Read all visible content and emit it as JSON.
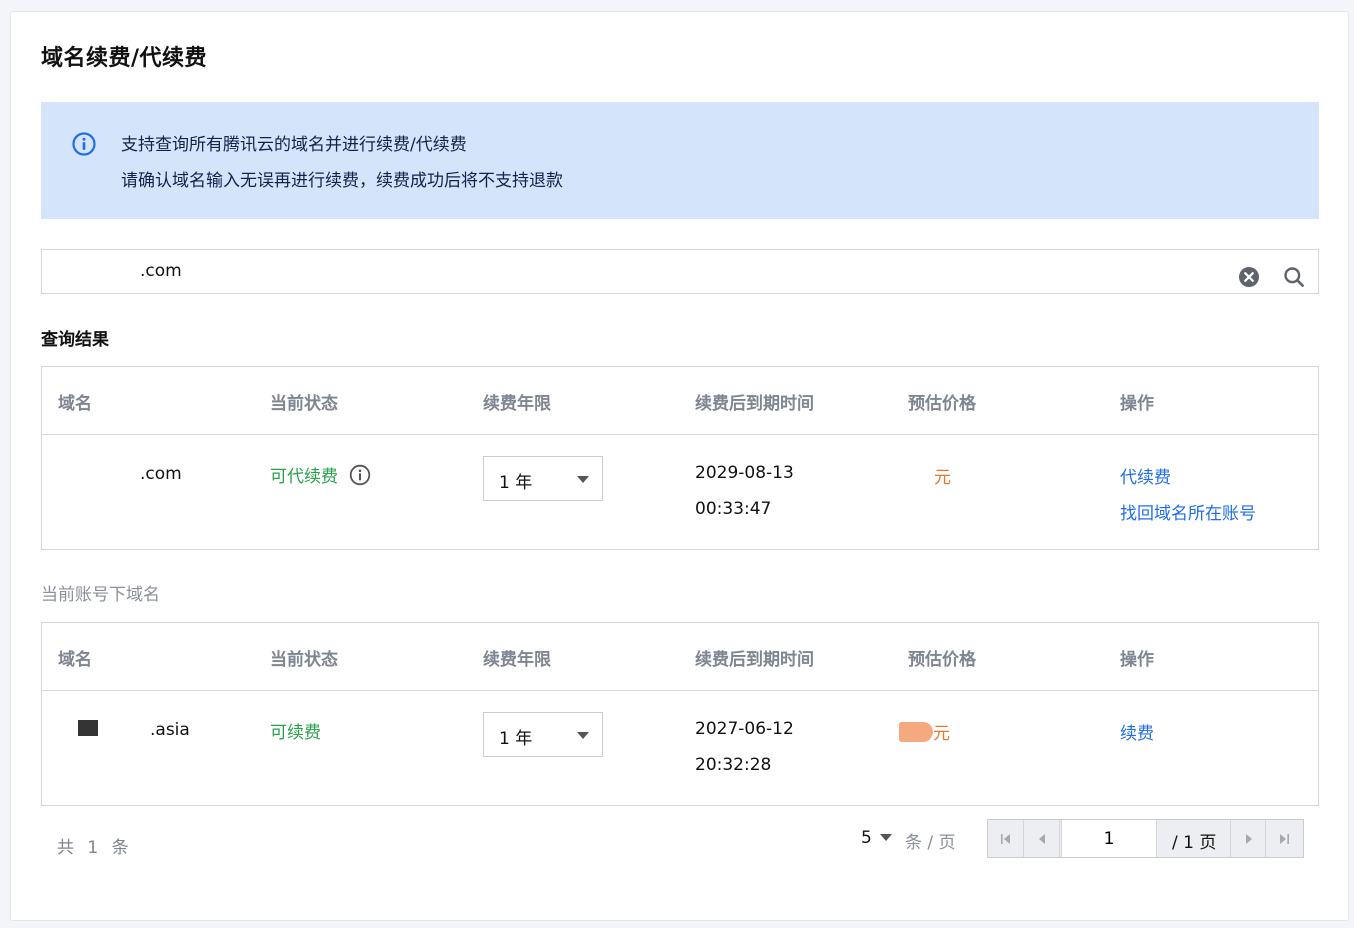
{
  "page": {
    "title": "域名续费/代续费"
  },
  "notice": {
    "line1": "支持查询所有腾讯云的域名并进行续费/代续费",
    "line2": "请确认域名输入无误再进行续费，续费成功后将不支持退款"
  },
  "search": {
    "value": ".com"
  },
  "query_results": {
    "title": "查询结果",
    "headers": [
      "域名",
      "当前状态",
      "续费年限",
      "续费后到期时间",
      "预估价格",
      "操作"
    ],
    "rows": [
      {
        "domain": ".com",
        "status": "可代续费",
        "term": "1 年",
        "expire_date": "2029-08-13",
        "expire_time": "00:33:47",
        "price_unit": "元",
        "actions": [
          "代续费",
          "找回域名所在账号"
        ]
      }
    ]
  },
  "account_domains": {
    "title": "当前账号下域名",
    "headers": [
      "域名",
      "当前状态",
      "续费年限",
      "续费后到期时间",
      "预估价格",
      "操作"
    ],
    "rows": [
      {
        "domain": ".asia",
        "status": "可续费",
        "term": "1 年",
        "expire_date": "2027-06-12",
        "expire_time": "20:32:28",
        "price_unit": "元",
        "actions": [
          "续费"
        ]
      }
    ]
  },
  "pagination": {
    "total_text": "共 1 条",
    "page_size": "5",
    "page_size_label": "条 / 页",
    "current_page": "1",
    "total_pages": "/ 1 页"
  },
  "colors": {
    "accent": "#1f6ee8",
    "success": "#28a14a",
    "price": "#e8772e",
    "notice_bg": "#d4e4fb"
  }
}
